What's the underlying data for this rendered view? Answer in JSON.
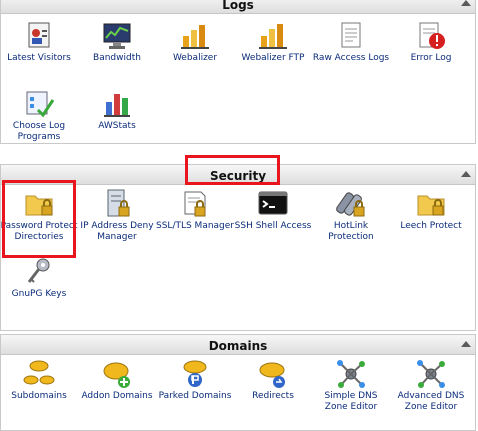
{
  "logs": {
    "title": "Logs",
    "items": [
      {
        "label": "Latest Visitors",
        "icon": "visitors-icon"
      },
      {
        "label": "Bandwidth",
        "icon": "bandwidth-icon"
      },
      {
        "label": "Webalizer",
        "icon": "webalizer-icon"
      },
      {
        "label": "Webalizer FTP",
        "icon": "webalizer-ftp-icon"
      },
      {
        "label": "Raw Access Logs",
        "icon": "raw-access-icon"
      },
      {
        "label": "Error Log",
        "icon": "error-log-icon"
      },
      {
        "label": "Choose Log Programs",
        "icon": "log-programs-icon"
      },
      {
        "label": "AWStats",
        "icon": "awstats-icon"
      }
    ]
  },
  "security": {
    "title": "Security",
    "items": [
      {
        "label": "Password Protect Directories",
        "icon": "folder-lock-icon"
      },
      {
        "label": "IP Address Deny Manager",
        "icon": "server-lock-icon"
      },
      {
        "label": "SSL/TLS Manager",
        "icon": "ssl-icon"
      },
      {
        "label": "SSH Shell Access",
        "icon": "terminal-icon"
      },
      {
        "label": "HotLink Protection",
        "icon": "hotlink-icon"
      },
      {
        "label": "Leech Protect",
        "icon": "leech-protect-icon"
      },
      {
        "label": "GnuPG Keys",
        "icon": "keys-icon"
      }
    ]
  },
  "domains": {
    "title": "Domains",
    "items": [
      {
        "label": "Subdomains",
        "icon": "subdomains-icon"
      },
      {
        "label": "Addon Domains",
        "icon": "addon-domains-icon"
      },
      {
        "label": "Parked Domains",
        "icon": "parked-domains-icon"
      },
      {
        "label": "Redirects",
        "icon": "redirects-icon"
      },
      {
        "label": "Simple DNS Zone Editor",
        "icon": "dns-simple-icon"
      },
      {
        "label": "Advanced DNS Zone Editor",
        "icon": "dns-advanced-icon"
      }
    ]
  },
  "colors": {
    "highlight": "#e8141e",
    "link": "#0b2c7a"
  }
}
